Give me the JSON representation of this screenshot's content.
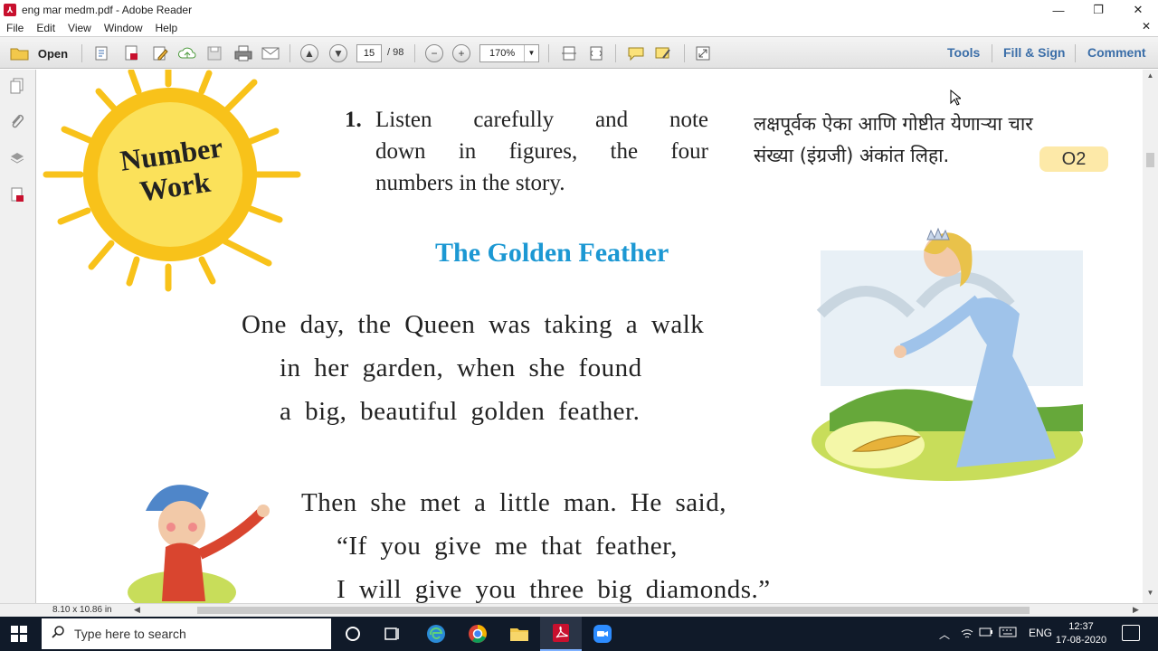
{
  "window": {
    "title": "eng mar medm.pdf - Adobe Reader",
    "controls": {
      "minimize": "—",
      "restore": "❐",
      "close": "✕"
    }
  },
  "menu": {
    "items": [
      "File",
      "Edit",
      "View",
      "Window",
      "Help"
    ],
    "close_glyph": "✕"
  },
  "toolbar": {
    "open_label": "Open",
    "page_current": "15",
    "page_total": "/ 98",
    "zoom": "170%",
    "tools_label": "Tools",
    "fillsign_label": "Fill & Sign",
    "comment_label": "Comment",
    "colors": {
      "panel_link": "#3b6ea8"
    }
  },
  "document": {
    "question_number": "1.",
    "question_lines": [
      "Listen carefully and note",
      "down in figures, the four",
      "numbers in the story."
    ],
    "marathi_lines": [
      "लक्षपूर्वक ऐका आणि गोष्टीत येणाऱ्या चार",
      "संख्या (इंग्रजी) अंकांत लिहा."
    ],
    "badge": "O2",
    "sun_text": [
      "Number",
      "Work"
    ],
    "story_title": "The Golden Feather",
    "story_para1": [
      "One day, the Queen was taking a walk",
      "in her garden, when she found",
      "a big, beautiful golden feather."
    ],
    "story_para2": [
      "Then she met a little man. He said,",
      "“If you give me that feather,",
      "I will give you three big diamonds.”"
    ],
    "colors": {
      "title": "#1c98d3",
      "sun": "#f8c21a",
      "badge_bg": "#fde9a8"
    }
  },
  "statusbar": {
    "page_size": "8.10 x 10.86 in"
  },
  "taskbar": {
    "search_placeholder": "Type here to search",
    "language": "ENG",
    "time": "12:37",
    "date": "17-08-2020"
  }
}
